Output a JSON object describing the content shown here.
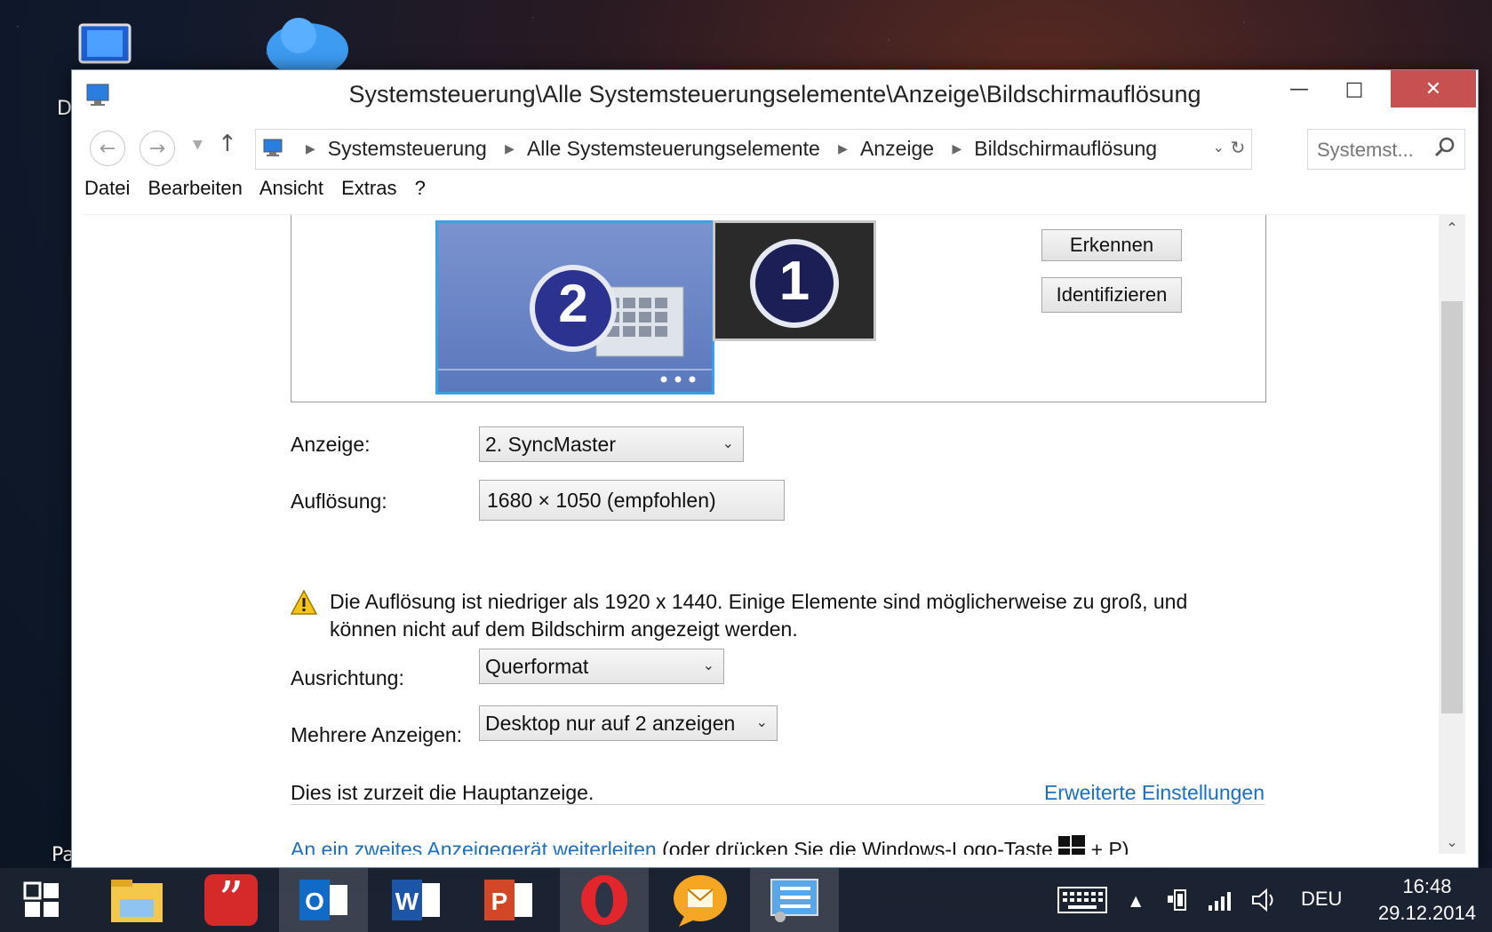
{
  "window": {
    "title": "Systemsteuerung\\Alle Systemsteuerungselemente\\Anzeige\\Bildschirmauflösung"
  },
  "address": {
    "crumbs": [
      "Systemsteuerung",
      "Alle Systemsteuerungselemente",
      "Anzeige",
      "Bildschirmauflösung"
    ],
    "search_placeholder": "Systemst..."
  },
  "menu": [
    "Datei",
    "Bearbeiten",
    "Ansicht",
    "Extras",
    "?"
  ],
  "monitors": {
    "selected": "2",
    "other": "1",
    "detect_label": "Erkennen",
    "identify_label": "Identifizieren"
  },
  "settings": {
    "display_label": "Anzeige:",
    "display_value": "2. SyncMaster",
    "resolution_label": "Auflösung:",
    "resolution_value": "1680 × 1050 (empfohlen)",
    "warning_text": "Die Auflösung ist niedriger als 1920 x 1440. Einige Elemente sind möglicherweise zu groß, und können nicht auf dem Bildschirm angezeigt werden.",
    "orientation_label": "Ausrichtung:",
    "orientation_value": "Querformat",
    "multi_label": "Mehrere Anzeigen:",
    "multi_value": "Desktop nur auf 2 anzeigen",
    "main_display_text": "Dies ist zurzeit die Hauptanzeige.",
    "advanced_link": "Erweiterte Einstellungen",
    "project_link": "An ein zweites Anzeigegerät weiterleiten",
    "project_hint_before": "(oder drücken Sie die Windows-Logo-Taste",
    "project_hint_after": "+ P)"
  },
  "desktop": {
    "label_1": "D",
    "label_2": "Pa"
  },
  "taskbar": {
    "language": "DEU",
    "time": "16:48",
    "date": "29.12.2014"
  },
  "colors": {
    "link": "#1a6fc2",
    "close_button": "#c75050",
    "selected_monitor": "#6a84c0"
  }
}
